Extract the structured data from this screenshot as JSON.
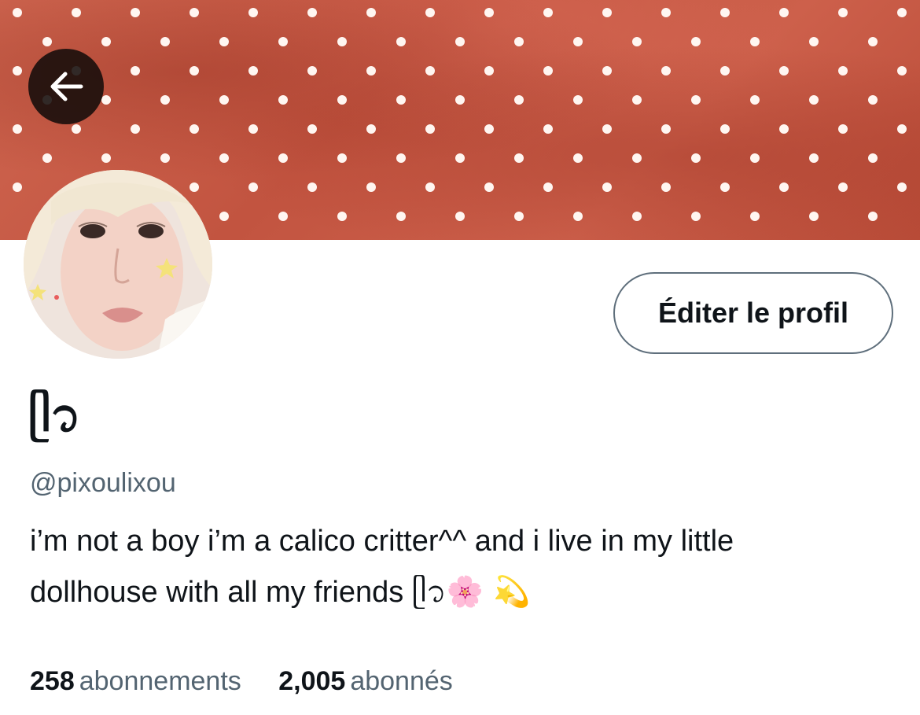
{
  "header": {
    "back_icon": "arrow-left-icon",
    "banner_colors": {
      "base": "#c65a45",
      "dot": "#fff6f1"
    }
  },
  "profile": {
    "avatar_icon": "profile-photo",
    "edit_button_label": "Éditer le profil",
    "display_name": "ᥫ᭡",
    "handle": "@pixoulixou",
    "bio_line_1": "i’m not a boy i’m a calico critter^^ and i live in my little",
    "bio_line_2_text": "dollhouse with all my friends ",
    "bio_line_2_symbol": "ᥫ᭡",
    "bio_line_2_emoji": "🌸 💫"
  },
  "stats": {
    "following_count": "258",
    "following_label": "abonnements",
    "followers_count": "2,005",
    "followers_label": "abonnés"
  },
  "colors": {
    "primary_text": "#0f1419",
    "secondary_text": "#536471",
    "button_border": "#5f6f7c"
  }
}
